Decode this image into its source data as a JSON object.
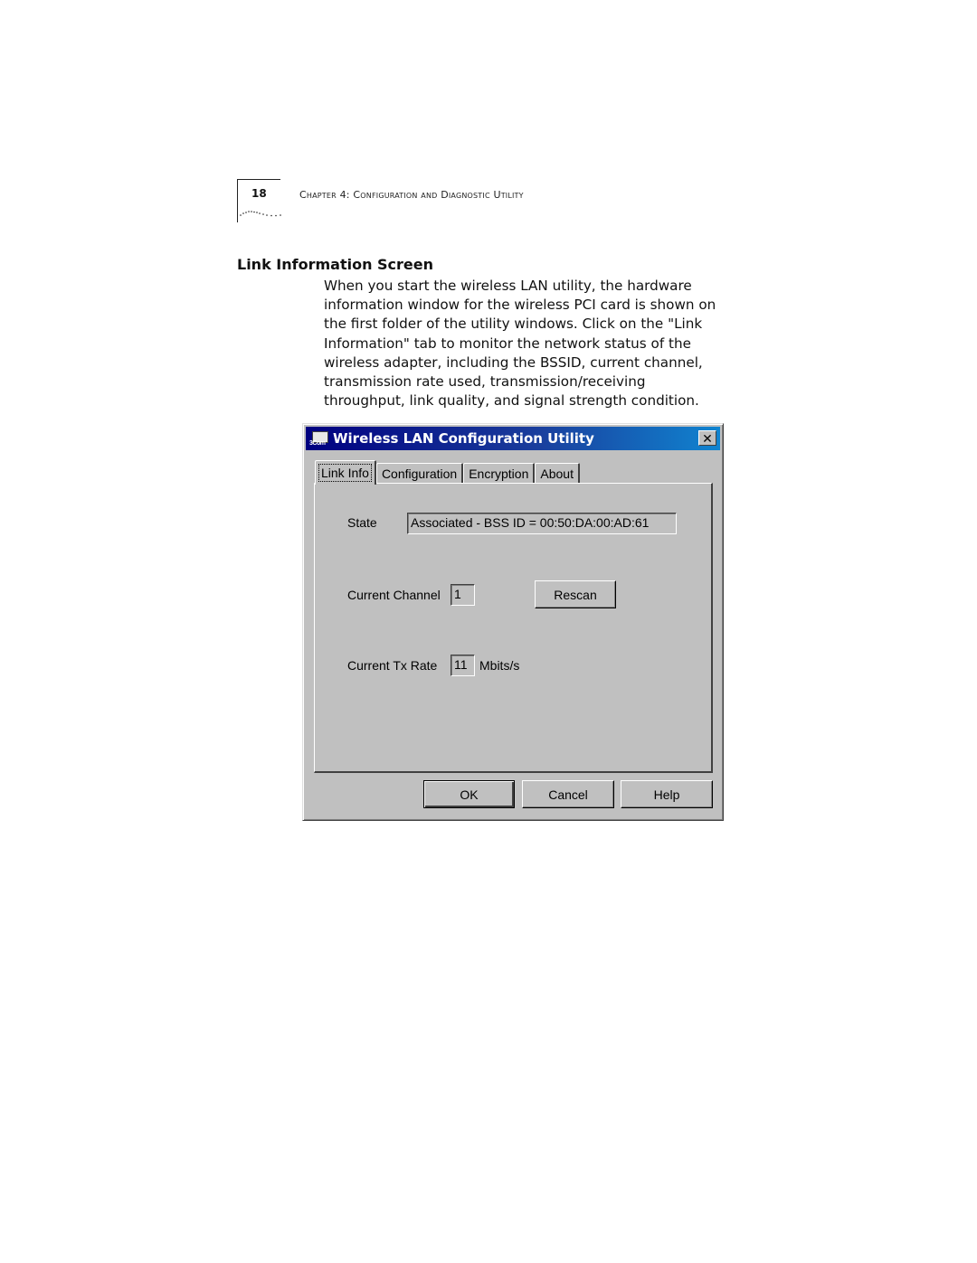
{
  "page": {
    "number": "18",
    "running_head": "Chapter 4: Configuration and Diagnostic Utility",
    "section_title": "Link Information Screen",
    "body_text": "When you start the wireless LAN utility, the hardware information window for the wireless PCI card is shown on the first folder of the utility windows. Click on the \"Link Information\" tab to monitor the network status of the wireless adapter, including the BSSID, current channel, transmission rate used, transmission/receiving throughput, link quality, and signal strength condition."
  },
  "dialog": {
    "title": "Wireless LAN Configuration Utility",
    "icon": "3com-app-icon",
    "icon_text": "3Com",
    "close_glyph": "✕",
    "colors": {
      "title_start": "#000080",
      "title_end": "#1084d0",
      "face": "#c0c0c0"
    },
    "tabs": [
      {
        "label": "Link Info",
        "active": true
      },
      {
        "label": "Configuration",
        "active": false
      },
      {
        "label": "Encryption",
        "active": false
      },
      {
        "label": "About",
        "active": false
      }
    ],
    "state": {
      "label": "State",
      "value": "Associated - BSS ID = 00:50:DA:00:AD:61"
    },
    "channel": {
      "label": "Current Channel",
      "value": "1"
    },
    "rescan_label": "Rescan",
    "tx_rate": {
      "label": "Current Tx Rate",
      "value": "11",
      "unit": "Mbits/s"
    },
    "buttons": {
      "ok": "OK",
      "cancel": "Cancel",
      "help": "Help"
    }
  }
}
